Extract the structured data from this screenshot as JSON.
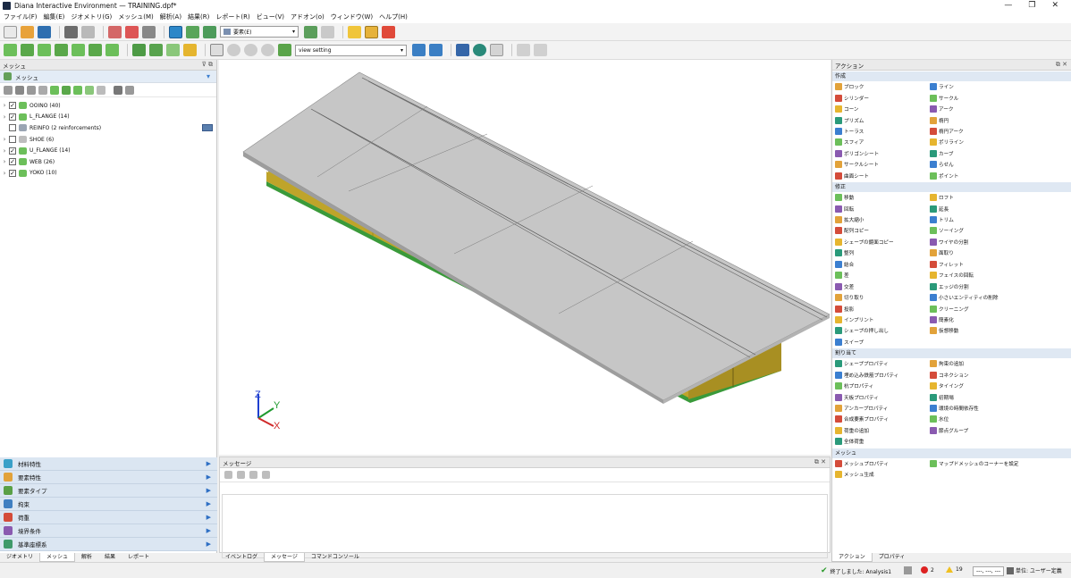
{
  "window": {
    "title": "Diana Interactive Environment — TRAINING.dpf*",
    "min_label": "—",
    "max_label": "❐",
    "close_label": "✕"
  },
  "menu": [
    "ファイル(F)",
    "編集(E)",
    "ジオメトリ(G)",
    "メッシュ(M)",
    "解析(A)",
    "結果(R)",
    "レポート(R)",
    "ビュー(V)",
    "アドオン(o)",
    "ウィンドウ(W)",
    "ヘルプ(H)"
  ],
  "toolbar1": {
    "element_combo": "要素(E)"
  },
  "toolbar2": {
    "view_combo": "view setting"
  },
  "left_panel": {
    "title": "メッシュ",
    "subheader": "メッシュ",
    "tree": [
      {
        "label": "OOINO (40)",
        "checked": true,
        "color": "#6cbf5a"
      },
      {
        "label": "L_FLANGE (14)",
        "checked": true,
        "color": "#6cbf5a"
      },
      {
        "label": "REINFO (2 reinforcements)",
        "checked": false,
        "color": "#9aa5b3"
      },
      {
        "label": "SHOE (6)",
        "checked": false,
        "color": "#bdbdbd"
      },
      {
        "label": "U_FLANGE (14)",
        "checked": true,
        "color": "#6cbf5a"
      },
      {
        "label": "WEB (26)",
        "checked": true,
        "color": "#6cbf5a"
      },
      {
        "label": "YOKO (10)",
        "checked": true,
        "color": "#6cbf5a"
      }
    ],
    "accordion": [
      {
        "icon_text": "Oc",
        "label": "材料特性",
        "color": "#3aa0c8"
      },
      {
        "icon_text": "",
        "label": "要素特性",
        "color": "#e2a23a"
      },
      {
        "icon_text": "",
        "label": "要素タイプ",
        "color": "#5aa046"
      },
      {
        "icon_text": "",
        "label": "拘束",
        "color": "#3f7fc1"
      },
      {
        "icon_text": "",
        "label": "荷重",
        "color": "#d44c3a"
      },
      {
        "icon_text": "",
        "label": "境界条件",
        "color": "#8a5ab0"
      },
      {
        "icon_text": "",
        "label": "基準座標系",
        "color": "#3f9a6a"
      }
    ],
    "tabs": [
      "ジオメトリ",
      "メッシュ",
      "解析",
      "結果",
      "レポート"
    ],
    "active_tab": "メッシュ"
  },
  "viewport": {
    "axes": {
      "x": "X",
      "y": "Y",
      "z": "Z"
    },
    "colors": {
      "deck_top": "#c4c4c4",
      "deck_edge": "#9d9d9d",
      "girder": "#bfa42a",
      "girder_dark": "#8c7a1c",
      "flange": "#3a9a3a"
    }
  },
  "messages": {
    "title": "メッセージ",
    "tabs": [
      "イベントログ",
      "メッセージ",
      "コマンドコンソール"
    ],
    "active_tab": "メッセージ"
  },
  "actions": {
    "title": "アクション",
    "sections": [
      {
        "name": "作成",
        "items": [
          "ブロック",
          "ライン",
          "シリンダー",
          "サークル",
          "コーン",
          "アーク",
          "プリズム",
          "楕円",
          "トーラス",
          "楕円アーク",
          "スフィア",
          "ポリライン",
          "ポリゴンシート",
          "カーブ",
          "サークルシート",
          "らせん",
          "曲面シート",
          "ポイント"
        ]
      },
      {
        "name": "修正",
        "items": [
          "移動",
          "ロフト",
          "回転",
          "延長",
          "拡大縮小",
          "トリム",
          "配列コピー",
          "ソーイング",
          "シェープの鏡面コピー",
          "ワイヤの分割",
          "整列",
          "面取り",
          "結合",
          "フィレット",
          "差",
          "フェイスの回転",
          "交差",
          "エッジの分割",
          "切り取り",
          "小さいエンティティの削除",
          "投影",
          "クリーニング",
          "インプリント",
          "簡素化",
          "シェープの押し出し",
          "仮想移動",
          "スイープ"
        ]
      },
      {
        "name": "割り当て",
        "items": [
          "シェーププロパティ",
          "拘束の追加",
          "埋め込み鉄筋プロパティ",
          "コネクション",
          "杭プロパティ",
          "タイイング",
          "天板プロパティ",
          "初期場",
          "アンカープロパティ",
          "環境の時間依存性",
          "合成要素プロパティ",
          "水位",
          "荷重の追加",
          "節点グループ",
          "全体荷重"
        ]
      },
      {
        "name": "メッシュ",
        "items": [
          "メッシュプロパティ",
          "マップドメッシュのコーナーを設定",
          "メッシュ生成"
        ]
      }
    ],
    "tabs": [
      "アクション",
      "プロパティ"
    ],
    "active_tab": "アクション"
  },
  "status": {
    "message": "終了しました: Analysis1",
    "errors": "2",
    "warnings": "19",
    "coords": "---, ---, ---",
    "units": "単位: ユーザー定義"
  }
}
